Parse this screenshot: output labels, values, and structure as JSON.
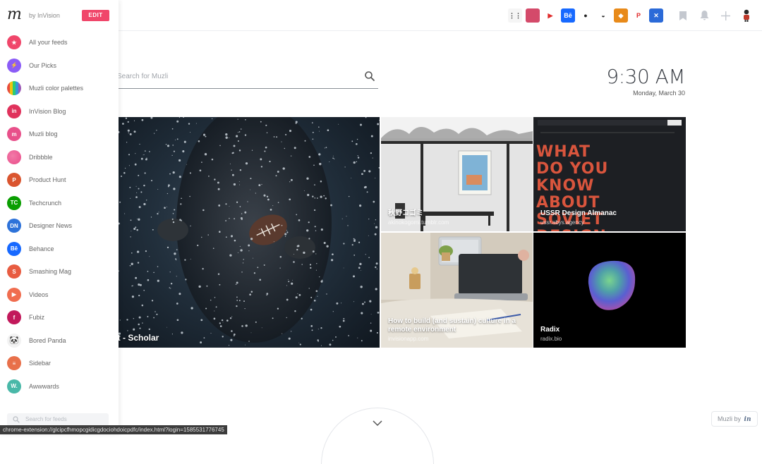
{
  "sidebar": {
    "logo": "m",
    "by_text": "by InVision",
    "edit_label": "EDIT",
    "search_placeholder": "Search for feeds",
    "items": [
      {
        "label": "All your feeds",
        "icon": "star-icon",
        "glyph": "★",
        "color": "#f0466a"
      },
      {
        "label": "Our Picks",
        "icon": "bolt-icon",
        "glyph": "⚡",
        "color": "#8b5cf6"
      },
      {
        "label": "Muzli color palettes",
        "icon": "palette-icon",
        "glyph": "",
        "color": "#e86b3a"
      },
      {
        "label": "InVision Blog",
        "icon": "invision-icon",
        "glyph": "in",
        "color": "#e0325c"
      },
      {
        "label": "Muzli blog",
        "icon": "muzli-icon",
        "glyph": "m",
        "color": "#e8508a"
      },
      {
        "label": "Dribbble",
        "icon": "dribbble-icon",
        "glyph": "",
        "color": "#ea4c89"
      },
      {
        "label": "Product Hunt",
        "icon": "producthunt-icon",
        "glyph": "P",
        "color": "#da552f"
      },
      {
        "label": "Techcrunch",
        "icon": "techcrunch-icon",
        "glyph": "TC",
        "color": "#0a9e01"
      },
      {
        "label": "Designer News",
        "icon": "designernews-icon",
        "glyph": "DN",
        "color": "#2d72d9"
      },
      {
        "label": "Behance",
        "icon": "behance-icon",
        "glyph": "Bē",
        "color": "#1769ff"
      },
      {
        "label": "Smashing Mag",
        "icon": "smashing-icon",
        "glyph": "S",
        "color": "#e85c41"
      },
      {
        "label": "Videos",
        "icon": "play-icon",
        "glyph": "▶",
        "color": "#f06d4f"
      },
      {
        "label": "Fubiz",
        "icon": "fubiz-icon",
        "glyph": "f",
        "color": "#c2185b"
      },
      {
        "label": "Bored Panda",
        "icon": "panda-icon",
        "glyph": "🐼",
        "color": "#f2f2f2"
      },
      {
        "label": "Sidebar",
        "icon": "sidebar-icon",
        "glyph": "≡",
        "color": "#e8704a"
      },
      {
        "label": "Awwwards",
        "icon": "awwwards-icon",
        "glyph": "W.",
        "color": "#49b8a8"
      }
    ]
  },
  "topbar": {
    "extensions": [
      {
        "name": "apps-grid-icon",
        "color": "#f5f5f5",
        "glyph": "⋮⋮"
      },
      {
        "name": "dribbble-shot-icon",
        "color": "#d44a6a",
        "glyph": ""
      },
      {
        "name": "youtube-icon",
        "color": "#ffffff",
        "glyph": "▶"
      },
      {
        "name": "behance-icon",
        "color": "#1769ff",
        "glyph": "Bē"
      },
      {
        "name": "github-icon",
        "color": "#ffffff",
        "glyph": "●"
      },
      {
        "name": "avatar-icon",
        "color": "#ffffff",
        "glyph": "◒"
      },
      {
        "name": "extension-icon",
        "color": "#e88a1a",
        "glyph": "◆"
      },
      {
        "name": "pinterest-icon",
        "color": "#ffffff",
        "glyph": "P"
      },
      {
        "name": "x-extension-icon",
        "color": "#2b6ad8",
        "glyph": "✕"
      }
    ]
  },
  "search": {
    "placeholder": "Search for Muzli"
  },
  "clock": {
    "time": "9:30 AM",
    "date": "Monday, March 30"
  },
  "cards": {
    "big": {
      "title": "at - Scholar",
      "domain": ""
    },
    "japan": {
      "title": "秋野コゴミ",
      "domain": "akinokogomi.tumblr.com"
    },
    "ussr": {
      "title": "USSR Design Almanac",
      "domain": "ussr.abys.agency",
      "poster_text": "WHAT DO YOU KNOW ABOUT SOVIET DESIGN"
    },
    "build": {
      "title": "How to build (and sustain) culture in a remote environment",
      "domain": "invisionapp.com"
    },
    "radix": {
      "title": "Radix",
      "domain": "radix.bio"
    }
  },
  "status_url": "chrome-extension://glcipcfhmopcgidicgdociohdoicpdfc/index.html?login=1585531776745",
  "footer": {
    "muzli_by": "Muzli by",
    "in": "in"
  }
}
